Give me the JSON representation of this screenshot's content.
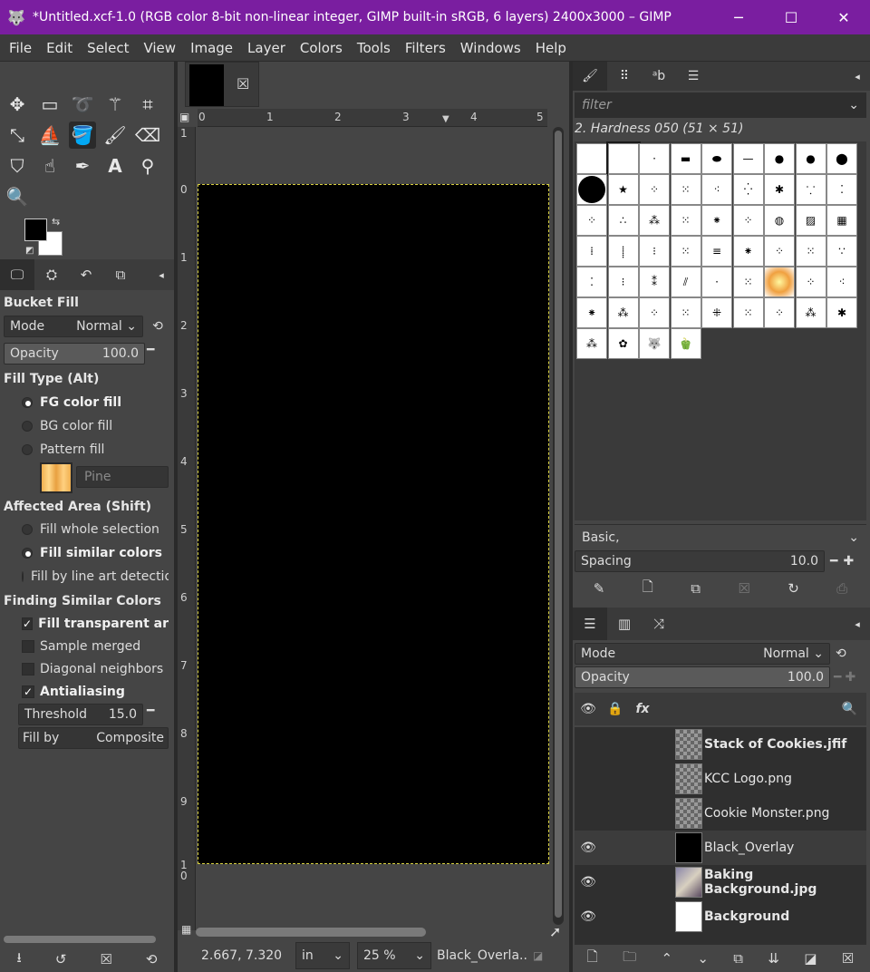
{
  "window": {
    "title": "*Untitled.xcf-1.0 (RGB color 8-bit non-linear integer, GIMP built-in sRGB, 6 layers) 2400x3000 – GIMP",
    "minimize": "─",
    "maximize": "☐",
    "close": "✕"
  },
  "menu": [
    "File",
    "Edit",
    "Select",
    "View",
    "Image",
    "Layer",
    "Colors",
    "Tools",
    "Filters",
    "Windows",
    "Help"
  ],
  "tool_options": {
    "title": "Bucket Fill",
    "mode_label": "Mode",
    "mode_value": "Normal",
    "opacity_label": "Opacity",
    "opacity_value": "100.0",
    "fill_type_label": "Fill Type  (Alt)",
    "fill_type_options": [
      "FG color fill",
      "BG color fill",
      "Pattern fill"
    ],
    "pattern_name": "Pine",
    "affected_area_label": "Affected Area  (Shift)",
    "affected_area_options": [
      "Fill whole selection",
      "Fill similar colors",
      "Fill by line art detectio"
    ],
    "finding_label": "Finding Similar Colors",
    "checks": [
      "Fill transparent areas",
      "Sample merged",
      "Diagonal neighbors",
      "Antialiasing"
    ],
    "threshold_label": "Threshold",
    "threshold_value": "15.0",
    "fill_by_label": "Fill by",
    "fill_by_value": "Composite"
  },
  "canvas": {
    "h_ruler": [
      "0",
      "1",
      "2",
      "3",
      "4",
      "5"
    ],
    "v_ruler": [
      "1",
      "0",
      "1",
      "2",
      "3",
      "4",
      "5",
      "6",
      "7",
      "8",
      "9",
      "1\n0"
    ]
  },
  "status": {
    "coords": "2.667, 7.320",
    "unit": "in",
    "zoom": "25 %",
    "layer": "Black_Overla..."
  },
  "brushes": {
    "filter_placeholder": "filter",
    "current": "2. Hardness 050 (51 × 51)",
    "preset": "Basic,",
    "spacing_label": "Spacing",
    "spacing_value": "10.0"
  },
  "layers_panel": {
    "mode_label": "Mode",
    "mode_value": "Normal",
    "opacity_label": "Opacity",
    "opacity_value": "100.0",
    "fx": "fx",
    "layers": [
      {
        "name": "Stack of Cookies.jfif",
        "visible": false,
        "bold": true
      },
      {
        "name": "KCC Logo.png",
        "visible": false,
        "bold": false
      },
      {
        "name": "Cookie Monster.png",
        "visible": false,
        "bold": false
      },
      {
        "name": "Black_Overlay",
        "visible": true,
        "bold": false
      },
      {
        "name": "Baking Background.jpg",
        "visible": true,
        "bold": true
      },
      {
        "name": "Background",
        "visible": true,
        "bold": true
      }
    ]
  },
  "colors": {
    "titlebar": "#7a1ea0",
    "fg": "#000000",
    "bg": "#ffffff"
  }
}
